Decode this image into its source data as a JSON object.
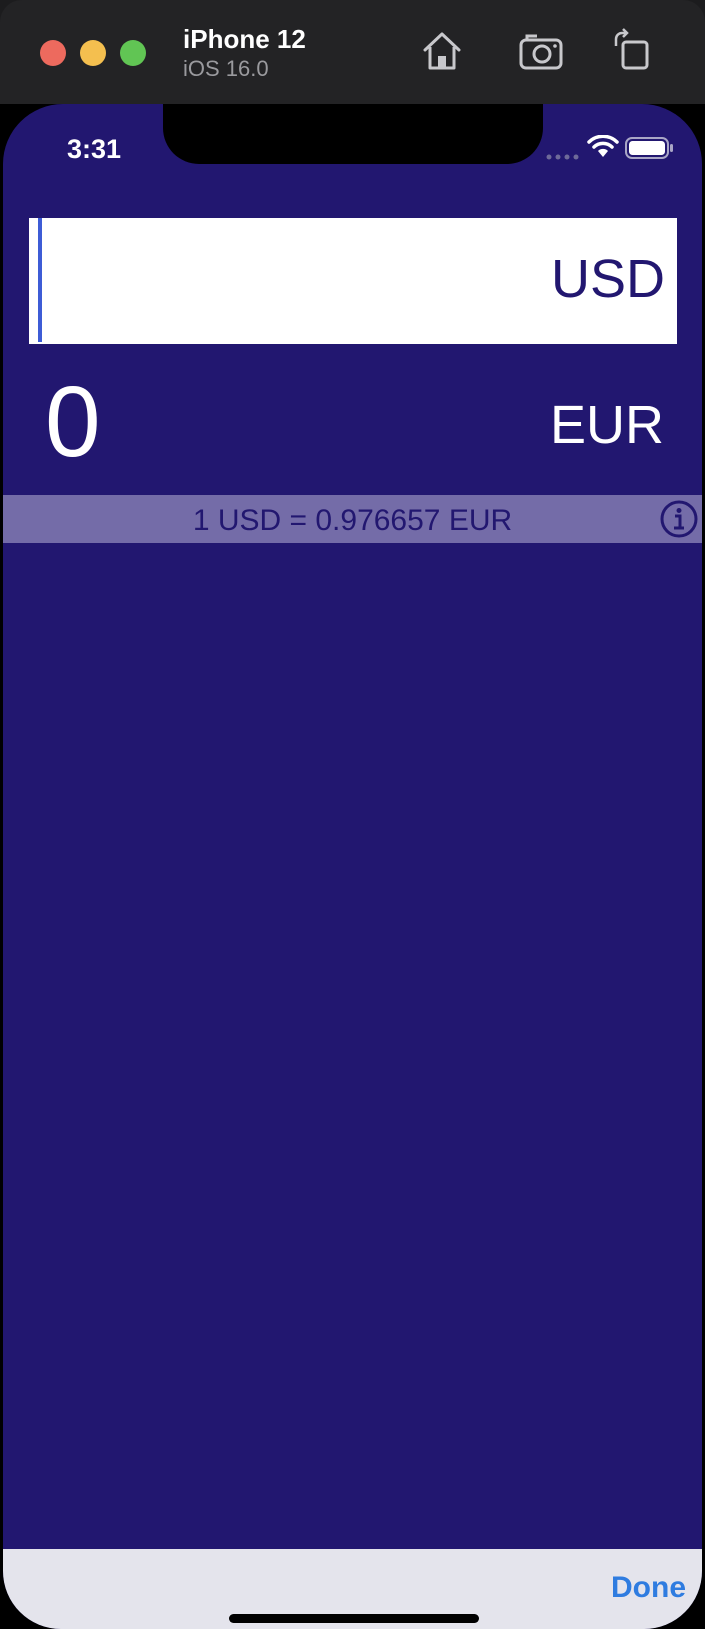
{
  "simulator": {
    "device_name": "iPhone 12",
    "os_version": "iOS 16.0",
    "toolbar_icons": [
      "home-icon",
      "screenshot-icon",
      "rotate-icon"
    ]
  },
  "status_bar": {
    "time": "3:31",
    "icons": [
      "signal-dots-icon",
      "wifi-icon",
      "battery-icon"
    ]
  },
  "converter": {
    "input_value": "",
    "input_currency": "USD",
    "result_value": "0",
    "result_currency": "EUR",
    "rate_text": "1 USD = 0.976657 EUR",
    "info_icon": "info-icon"
  },
  "keyboard_toolbar": {
    "done_label": "Done"
  },
  "colors": {
    "background": "#221770",
    "input_background": "#ffffff",
    "rate_bar": "#746ca8",
    "accent": "#2f7ce0"
  }
}
